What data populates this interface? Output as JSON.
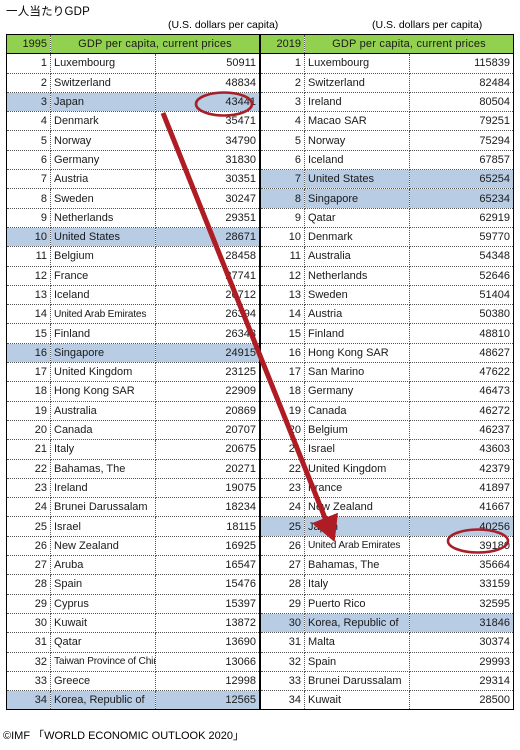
{
  "title": "一人当たりGDP",
  "units_caption": "(U.S. dollars per capita)",
  "source": "©IMF 「WORLD ECONOMIC OUTLOOK 2020」",
  "colors": {
    "header_green": "#92d14f",
    "highlight_blue": "#b8cce4",
    "annotation_red": "#b01c23"
  },
  "tables": [
    {
      "year": "1995",
      "caption": "GDP per capita, current prices",
      "units": "(U.S. dollars per capita)",
      "rows": [
        {
          "rank": "1",
          "country": "Luxembourg",
          "value": "50911",
          "hl": false
        },
        {
          "rank": "2",
          "country": "Switzerland",
          "value": "48834",
          "hl": false
        },
        {
          "rank": "3",
          "country": "Japan",
          "value": "43441",
          "hl": true
        },
        {
          "rank": "4",
          "country": "Denmark",
          "value": "35471",
          "hl": false
        },
        {
          "rank": "5",
          "country": "Norway",
          "value": "34790",
          "hl": false
        },
        {
          "rank": "6",
          "country": "Germany",
          "value": "31830",
          "hl": false
        },
        {
          "rank": "7",
          "country": "Austria",
          "value": "30351",
          "hl": false
        },
        {
          "rank": "8",
          "country": "Sweden",
          "value": "30247",
          "hl": false
        },
        {
          "rank": "9",
          "country": "Netherlands",
          "value": "29351",
          "hl": false
        },
        {
          "rank": "10",
          "country": "United States",
          "value": "28671",
          "hl": true
        },
        {
          "rank": "11",
          "country": "Belgium",
          "value": "28458",
          "hl": false
        },
        {
          "rank": "12",
          "country": "France",
          "value": "27741",
          "hl": false
        },
        {
          "rank": "13",
          "country": "Iceland",
          "value": "26712",
          "hl": false
        },
        {
          "rank": "14",
          "country": "United Arab Emirates",
          "value": "26394",
          "hl": false
        },
        {
          "rank": "15",
          "country": "Finland",
          "value": "26348",
          "hl": false
        },
        {
          "rank": "16",
          "country": "Singapore",
          "value": "24915",
          "hl": true
        },
        {
          "rank": "17",
          "country": "United Kingdom",
          "value": "23125",
          "hl": false
        },
        {
          "rank": "18",
          "country": "Hong Kong SAR",
          "value": "22909",
          "hl": false
        },
        {
          "rank": "19",
          "country": "Australia",
          "value": "20869",
          "hl": false
        },
        {
          "rank": "20",
          "country": "Canada",
          "value": "20707",
          "hl": false
        },
        {
          "rank": "21",
          "country": "Italy",
          "value": "20675",
          "hl": false
        },
        {
          "rank": "22",
          "country": "Bahamas, The",
          "value": "20271",
          "hl": false
        },
        {
          "rank": "23",
          "country": "Ireland",
          "value": "19075",
          "hl": false
        },
        {
          "rank": "24",
          "country": "Brunei Darussalam",
          "value": "18234",
          "hl": false
        },
        {
          "rank": "25",
          "country": "Israel",
          "value": "18115",
          "hl": false
        },
        {
          "rank": "26",
          "country": "New Zealand",
          "value": "16925",
          "hl": false
        },
        {
          "rank": "27",
          "country": "Aruba",
          "value": "16547",
          "hl": false
        },
        {
          "rank": "28",
          "country": "Spain",
          "value": "15476",
          "hl": false
        },
        {
          "rank": "29",
          "country": "Cyprus",
          "value": "15397",
          "hl": false
        },
        {
          "rank": "30",
          "country": "Kuwait",
          "value": "13872",
          "hl": false
        },
        {
          "rank": "31",
          "country": "Qatar",
          "value": "13690",
          "hl": false
        },
        {
          "rank": "32",
          "country": "Taiwan Province of China",
          "value": "13066",
          "hl": false
        },
        {
          "rank": "33",
          "country": "Greece",
          "value": "12998",
          "hl": false
        },
        {
          "rank": "34",
          "country": "Korea, Republic of",
          "value": "12565",
          "hl": true
        }
      ]
    },
    {
      "year": "2019",
      "caption": "GDP per capita, current prices",
      "units": "(U.S. dollars per capita)",
      "rows": [
        {
          "rank": "1",
          "country": "Luxembourg",
          "value": "115839",
          "hl": false
        },
        {
          "rank": "2",
          "country": "Switzerland",
          "value": "82484",
          "hl": false
        },
        {
          "rank": "3",
          "country": "Ireland",
          "value": "80504",
          "hl": false
        },
        {
          "rank": "4",
          "country": "Macao SAR",
          "value": "79251",
          "hl": false
        },
        {
          "rank": "5",
          "country": "Norway",
          "value": "75294",
          "hl": false
        },
        {
          "rank": "6",
          "country": "Iceland",
          "value": "67857",
          "hl": false
        },
        {
          "rank": "7",
          "country": "United States",
          "value": "65254",
          "hl": true
        },
        {
          "rank": "8",
          "country": "Singapore",
          "value": "65234",
          "hl": true
        },
        {
          "rank": "9",
          "country": "Qatar",
          "value": "62919",
          "hl": false
        },
        {
          "rank": "10",
          "country": "Denmark",
          "value": "59770",
          "hl": false
        },
        {
          "rank": "11",
          "country": "Australia",
          "value": "54348",
          "hl": false
        },
        {
          "rank": "12",
          "country": "Netherlands",
          "value": "52646",
          "hl": false
        },
        {
          "rank": "13",
          "country": "Sweden",
          "value": "51404",
          "hl": false
        },
        {
          "rank": "14",
          "country": "Austria",
          "value": "50380",
          "hl": false
        },
        {
          "rank": "15",
          "country": "Finland",
          "value": "48810",
          "hl": false
        },
        {
          "rank": "16",
          "country": "Hong Kong SAR",
          "value": "48627",
          "hl": false
        },
        {
          "rank": "17",
          "country": "San Marino",
          "value": "47622",
          "hl": false
        },
        {
          "rank": "18",
          "country": "Germany",
          "value": "46473",
          "hl": false
        },
        {
          "rank": "19",
          "country": "Canada",
          "value": "46272",
          "hl": false
        },
        {
          "rank": "20",
          "country": "Belgium",
          "value": "46237",
          "hl": false
        },
        {
          "rank": "21",
          "country": "Israel",
          "value": "43603",
          "hl": false
        },
        {
          "rank": "22",
          "country": "United Kingdom",
          "value": "42379",
          "hl": false
        },
        {
          "rank": "23",
          "country": "France",
          "value": "41897",
          "hl": false
        },
        {
          "rank": "24",
          "country": "New Zealand",
          "value": "41667",
          "hl": false
        },
        {
          "rank": "25",
          "country": "Japan",
          "value": "40256",
          "hl": true
        },
        {
          "rank": "26",
          "country": "United Arab Emirates",
          "value": "39180",
          "hl": false
        },
        {
          "rank": "27",
          "country": "Bahamas, The",
          "value": "35664",
          "hl": false
        },
        {
          "rank": "28",
          "country": "Italy",
          "value": "33159",
          "hl": false
        },
        {
          "rank": "29",
          "country": "Puerto Rico",
          "value": "32595",
          "hl": false
        },
        {
          "rank": "30",
          "country": "Korea, Republic of",
          "value": "31846",
          "hl": true
        },
        {
          "rank": "31",
          "country": "Malta",
          "value": "30374",
          "hl": false
        },
        {
          "rank": "32",
          "country": "Spain",
          "value": "29993",
          "hl": false
        },
        {
          "rank": "33",
          "country": "Brunei Darussalam",
          "value": "29314",
          "hl": false
        },
        {
          "rank": "34",
          "country": "Kuwait",
          "value": "28500",
          "hl": false
        }
      ]
    }
  ],
  "annotations": {
    "arrow_label": "japan-rank-drop-arrow",
    "ellipse_1995_label": "japan-1995-value-circle",
    "ellipse_2019_label": "japan-2019-value-circle"
  }
}
